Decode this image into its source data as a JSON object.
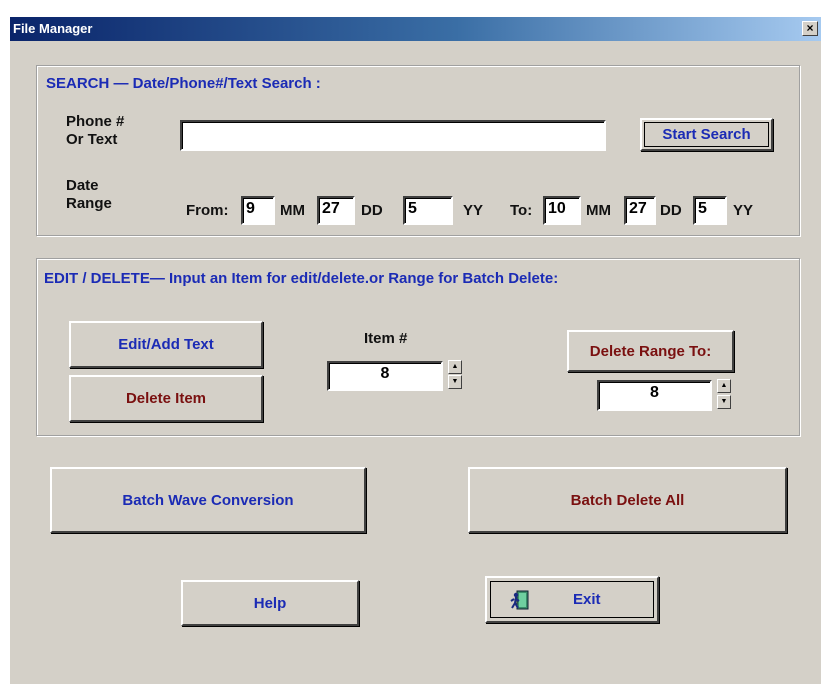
{
  "window": {
    "title": "File Manager",
    "close_glyph": "×"
  },
  "search": {
    "group_label": "SEARCH — Date/Phone#/Text Search :",
    "phone_label_line1": "Phone #",
    "phone_label_line2": "Or Text",
    "phone_value": "",
    "start_search_label": "Start Search",
    "date_label_line1": "Date",
    "date_label_line2": "Range",
    "from_label": "From:",
    "from_mm": "9",
    "mm_label": "MM",
    "from_dd": "27",
    "dd_label": "DD",
    "from_yy": "5",
    "yy_label": "YY",
    "to_label": "To:",
    "to_mm": "10",
    "to_dd": "27",
    "to_yy": "5"
  },
  "edit": {
    "group_label": "EDIT / DELETE— Input an Item for edit/delete.or Range for Batch Delete:",
    "edit_add_label": "Edit/Add Text",
    "delete_item_label": "Delete Item",
    "item_label": "Item #",
    "item_value": "8",
    "delete_range_label": "Delete Range To:",
    "range_value": "8",
    "spin_up": "▲",
    "spin_down": "▼"
  },
  "actions": {
    "batch_wave_label": "Batch Wave Conversion",
    "batch_delete_label": "Batch Delete All",
    "help_label": "Help",
    "exit_label": "Exit",
    "exit_icon": "exit-door-icon"
  },
  "colors": {
    "face": "#d4d0c8",
    "blue_text": "#1b2bb5",
    "red_text": "#7a1010",
    "title_start": "#0a246a",
    "title_end": "#a6caf0"
  }
}
